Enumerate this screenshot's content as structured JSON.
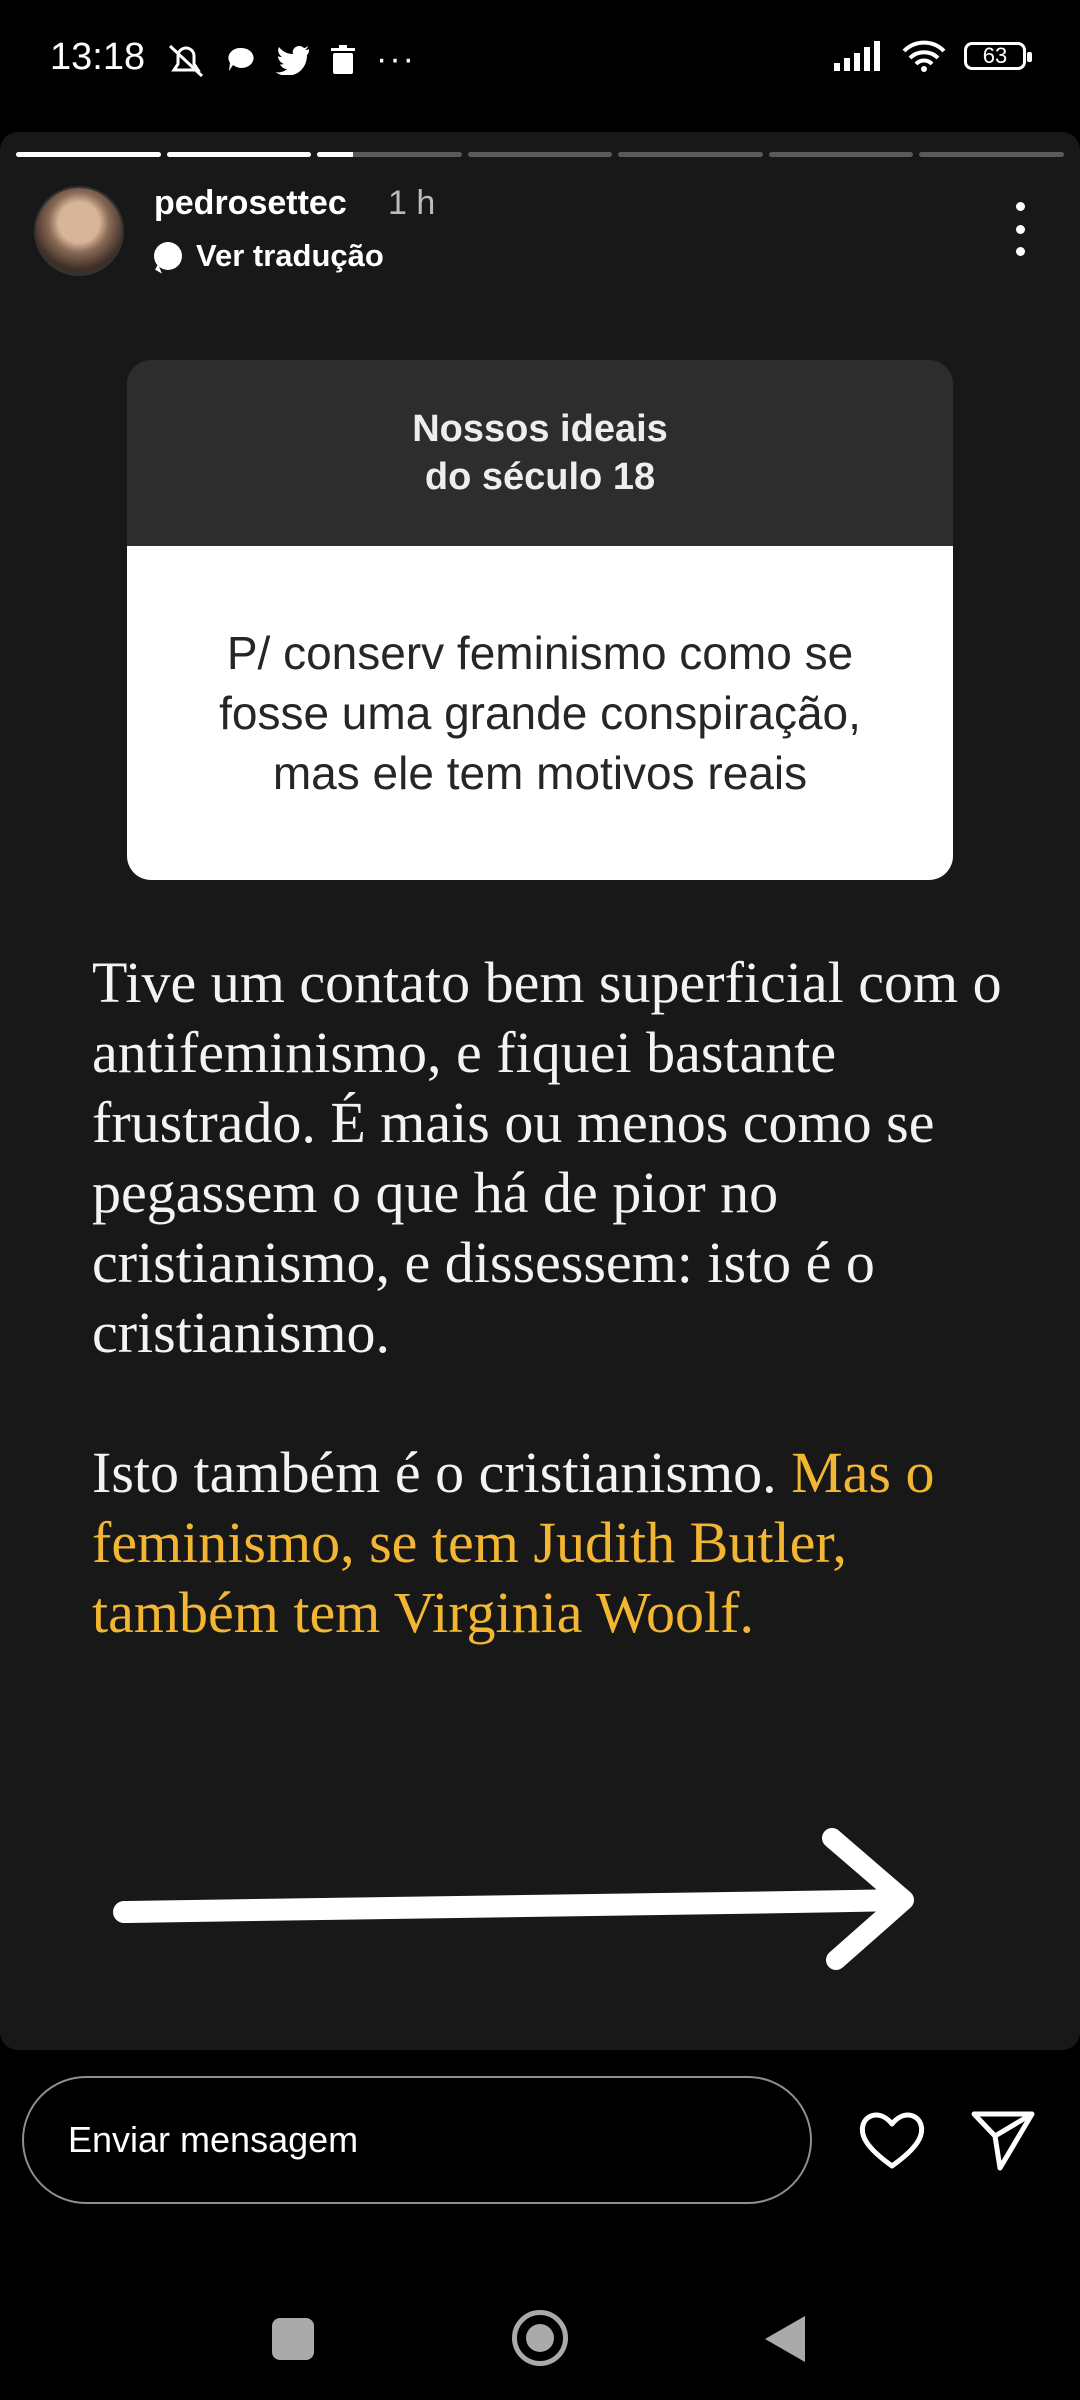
{
  "status_bar": {
    "time": "13:18",
    "more": "···",
    "battery": "63",
    "icons_left": [
      "muted-alarm-icon",
      "chat-bubble-icon",
      "twitter-icon",
      "trash-icon"
    ],
    "icons_right": [
      "signal-icon",
      "wifi-icon",
      "battery-icon"
    ]
  },
  "story": {
    "progress": {
      "segments": 7,
      "current": 3,
      "current_fill": 0.25
    },
    "username": "pedrosettec",
    "time_ago": "1 h",
    "translate_label": "Ver tradução",
    "question": {
      "header": "Nossos ideais\ndo século 18",
      "body": "P/ conserv feminismo como se\nfosse uma grande conspiração,\nmas ele tem motivos reais"
    },
    "text": {
      "para1": "Tive um contato bem superficial com o antifeminismo, e fiquei bastante frustrado. É mais ou menos como se pegassem o que há de pior no cristianismo, e dissessem: isto é o cristianismo.",
      "para2_plain": "Isto também é o cristianismo. ",
      "para2_highlight": "Mas o feminismo, se tem Judith Butler, também tem Virginia Woolf."
    },
    "colors": {
      "highlight": "#f3b633",
      "background": "#181818"
    }
  },
  "reply": {
    "placeholder": "Enviar mensagem"
  },
  "nav": {
    "icons": [
      "recent-apps-icon",
      "home-icon",
      "back-icon"
    ]
  }
}
